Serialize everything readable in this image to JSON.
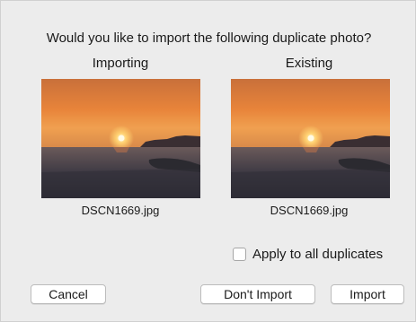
{
  "dialog": {
    "question": "Would you like to import the following duplicate photo?",
    "left": {
      "label": "Importing",
      "filename": "DSCN1669.jpg",
      "image": "sunset-over-sea-photo"
    },
    "right": {
      "label": "Existing",
      "filename": "DSCN1669.jpg",
      "image": "sunset-over-sea-photo"
    },
    "apply_all": {
      "label": "Apply to all duplicates",
      "checked": false
    },
    "buttons": {
      "cancel": "Cancel",
      "dont_import": "Don't Import",
      "import": "Import"
    }
  },
  "colors": {
    "dialog_background": "#ececec",
    "button_background": "#ffffff",
    "text": "#1a1a1a"
  }
}
